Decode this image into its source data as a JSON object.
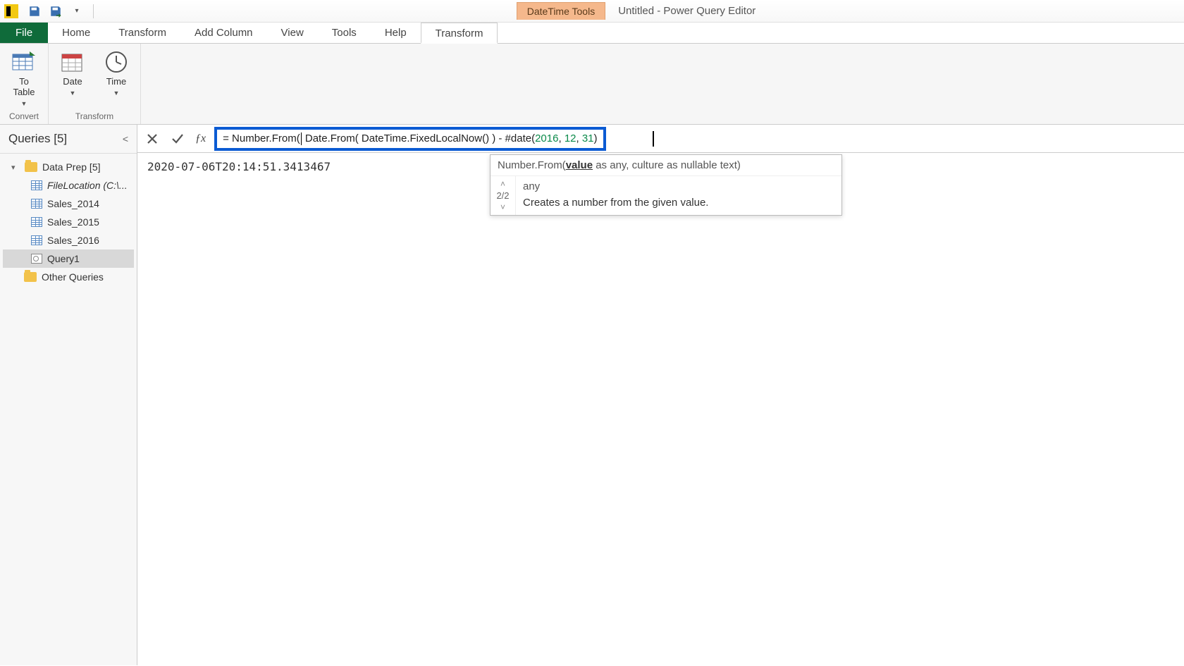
{
  "titlebar": {
    "context_tool_label": "DateTime Tools",
    "window_title": "Untitled - Power Query Editor"
  },
  "ribbon_tabs": {
    "file": "File",
    "items": [
      "Home",
      "Transform",
      "Add Column",
      "View",
      "Tools",
      "Help"
    ],
    "context": "Transform"
  },
  "ribbon": {
    "group1": {
      "btn_to_table": "To\nTable",
      "label": "Convert"
    },
    "group2": {
      "btn_date": "Date",
      "btn_time": "Time",
      "label": "Transform"
    }
  },
  "sidebar": {
    "title": "Queries [5]",
    "folder": "Data Prep [5]",
    "items": [
      "FileLocation (C:\\...",
      "Sales_2014",
      "Sales_2015",
      "Sales_2016",
      "Query1"
    ],
    "other": "Other Queries"
  },
  "formula": {
    "prefix": "= Number.From(",
    "mid": " Date.From( DateTime.FixedLocalNow() ) - #date(",
    "n1": "2016",
    "c1": ", ",
    "n2": "12",
    "c2": ", ",
    "n3": "31",
    "suffix": ")"
  },
  "result_value": "2020-07-06T20:14:51.3413467",
  "intellisense": {
    "sig_pre": "Number.From(",
    "sig_param": "value",
    "sig_post": " as any, culture as nullable text)",
    "counter": "2/2",
    "type": "any",
    "desc": "Creates a number from the given value."
  }
}
